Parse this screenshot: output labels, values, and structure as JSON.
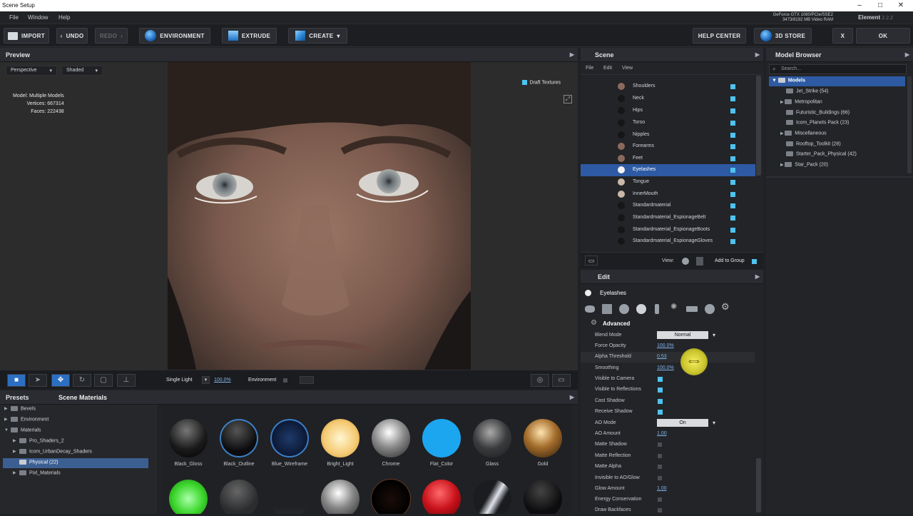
{
  "window": {
    "title": "Scene Setup",
    "minimize": "–",
    "maximize": "□",
    "close": "✕"
  },
  "menu": {
    "file": "File",
    "window": "Window",
    "help": "Help"
  },
  "gpu": {
    "line1": "GeForce GTX 1080/PCIe/SSE2",
    "line2": "3473/8192 MB Video RAM"
  },
  "app": {
    "name": "Element",
    "version": "2.2.2"
  },
  "toolbar": {
    "import": "IMPORT",
    "undo": "UNDO",
    "redo": "REDO",
    "environment": "ENVIRONMENT",
    "extrude": "EXTRUDE",
    "create": "CREATE",
    "help_center": "HELP CENTER",
    "store": "3D STORE",
    "close": "X",
    "ok": "OK"
  },
  "preview": {
    "title": "Preview",
    "camera": "Perspective",
    "shading": "Shaded",
    "stats": {
      "model_label": "Model:",
      "model": "Multiple Models",
      "vertices_label": "Vertices:",
      "vertices": "667314",
      "faces_label": "Faces:",
      "faces": "222438"
    },
    "draft_textures": "Draft Textures",
    "light": "Single Light",
    "light_pct": "100.0%",
    "environment": "Environment"
  },
  "presets": {
    "tab1": "Presets",
    "tab2": "Scene Materials",
    "tree": [
      {
        "label": "Bevels"
      },
      {
        "label": "Environment"
      },
      {
        "label": "Materials"
      },
      {
        "label": "Pro_Shaders_2"
      },
      {
        "label": "Icom_UrbanDecay_Shaders"
      },
      {
        "label": "Physical (22)"
      },
      {
        "label": "Pixl_Materials"
      }
    ],
    "materials": [
      {
        "name": "Black_Gloss"
      },
      {
        "name": "Black_Outline"
      },
      {
        "name": "Blue_Wireframe"
      },
      {
        "name": "Bright_Light"
      },
      {
        "name": "Chrome"
      },
      {
        "name": "Flat_Color"
      },
      {
        "name": "Glass"
      },
      {
        "name": "Gold"
      }
    ]
  },
  "scene": {
    "title": "Scene",
    "menu": {
      "file": "File",
      "edit": "Edit",
      "view": "View"
    },
    "rows": [
      {
        "name": "Shoulders"
      },
      {
        "name": "Neck"
      },
      {
        "name": "Hips"
      },
      {
        "name": "Torso"
      },
      {
        "name": "Nipples"
      },
      {
        "name": "Forearms"
      },
      {
        "name": "Feet"
      },
      {
        "name": "Eyelashes"
      },
      {
        "name": "Tongue"
      },
      {
        "name": "InnerMouth"
      },
      {
        "name": "Standardmaterial"
      },
      {
        "name": "Standardmaterial_EspionageBelt"
      },
      {
        "name": "Standardmaterial_EspionageBoots"
      },
      {
        "name": "Standardmaterial_EspionageGloves"
      }
    ],
    "view_label": "View:",
    "add_to_group": "Add to Group"
  },
  "edit": {
    "title": "Edit",
    "material": "Eyelashes",
    "section": "Advanced",
    "blend_mode": {
      "label": "Blend Mode",
      "value": "Normal"
    },
    "force_opacity": {
      "label": "Force Opacity",
      "value": "100.0%"
    },
    "alpha_threshold": {
      "label": "Alpha Threshold",
      "value": "0.53"
    },
    "smoothing": {
      "label": "Smoothing",
      "value": "100.0%"
    },
    "visible_camera": "Visible to Camera",
    "visible_reflections": "Visible to Reflections",
    "cast_shadow": "Cast Shadow",
    "receive_shadow": "Receive Shadow",
    "ao_mode": {
      "label": "AO Mode",
      "value": "On"
    },
    "ao_amount": {
      "label": "AO Amount",
      "value": "1.00"
    },
    "matte_shadow": "Matte Shadow",
    "matte_reflection": "Matte Reflection",
    "matte_alpha": "Matte Alpha",
    "invisible_ao": "Invisible to AO/Glow",
    "glow_amount": {
      "label": "Glow Amount",
      "value": "1.00"
    },
    "energy_conservation": "Energy Conservation",
    "draw_backfaces": "Draw Backfaces"
  },
  "browser": {
    "title": "Model Browser",
    "search_placeholder": "Search...",
    "items": [
      {
        "label": "Models"
      },
      {
        "label": "Jet_Strike (54)"
      },
      {
        "label": "Metropolitan"
      },
      {
        "label": "Futuristic_Buildings (66)"
      },
      {
        "label": "Icom_Planets Pack (23)"
      },
      {
        "label": "Miscellaneous"
      },
      {
        "label": "Rooftop_Toolkit (28)"
      },
      {
        "label": "Starter_Pack_Physical (42)"
      },
      {
        "label": "Star_Pack (20)"
      }
    ]
  },
  "colors": {
    "accent": "#4ec3f0",
    "selection": "#2d5aa3",
    "panel": "#232428"
  }
}
